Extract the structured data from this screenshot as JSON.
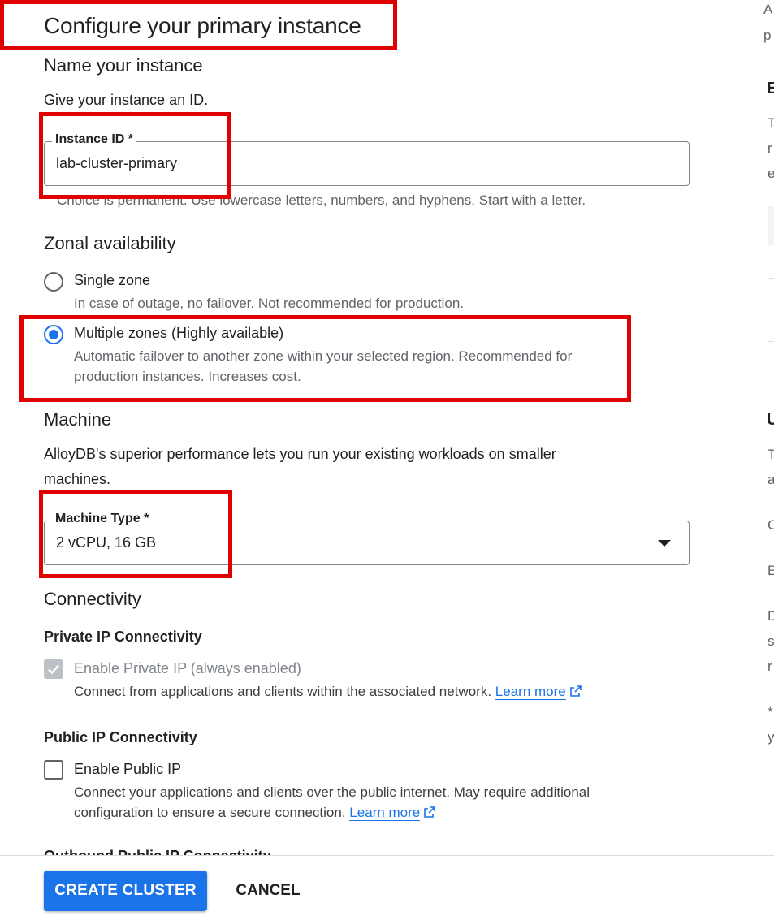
{
  "page": {
    "title": "Configure your primary instance"
  },
  "name_section": {
    "heading": "Name your instance",
    "description": "Give your instance an ID.",
    "instance_id_label": "Instance ID *",
    "instance_id_value": "lab-cluster-primary",
    "instance_id_helper": "Choice is permanent. Use lowercase letters, numbers, and hyphens. Start with a letter."
  },
  "zonal": {
    "heading": "Zonal availability",
    "options": [
      {
        "label": "Single zone",
        "description": "In case of outage, no failover. Not recommended for production.",
        "selected": false
      },
      {
        "label": "Multiple zones (Highly available)",
        "description_line1": "Automatic failover to another zone within your selected region. Recommended for",
        "description_line2": "production instances. Increases cost.",
        "selected": true
      }
    ]
  },
  "machine": {
    "heading": "Machine",
    "description_line1": "AlloyDB's superior performance lets you run your existing workloads on smaller",
    "description_line2": "machines.",
    "type_label": "Machine Type *",
    "type_value": "2 vCPU, 16 GB"
  },
  "connectivity": {
    "heading": "Connectivity",
    "private": {
      "heading": "Private IP Connectivity",
      "checkbox_label": "Enable Private IP (always enabled)",
      "checked": true,
      "disabled": true,
      "description": "Connect from applications and clients within the associated network.",
      "learn_more": "Learn more"
    },
    "public": {
      "heading": "Public IP Connectivity",
      "checkbox_label": "Enable Public IP",
      "checked": false,
      "description_line1": "Connect your applications and clients over the public internet. May require additional",
      "description_line2": "configuration to ensure a secure connection.",
      "learn_more": "Learn more"
    },
    "cutoff_heading": "Outbound Public IP Connectivity"
  },
  "actions": {
    "create": "CREATE CLUSTER",
    "cancel": "CANCEL"
  },
  "right_panel": {
    "fragments": [
      "A",
      "p",
      "E",
      "T",
      "r",
      "e",
      "U",
      "T",
      "a",
      "C",
      "E",
      "D",
      "s",
      "r",
      "*",
      "y"
    ]
  },
  "colors": {
    "primary": "#1a73e8",
    "annotation": "#e00000",
    "text": "#202124",
    "secondary_text": "#5f6368"
  },
  "icons": {
    "external_link": "external-link-icon",
    "dropdown": "arrow-drop-down-icon",
    "check": "check-icon"
  }
}
